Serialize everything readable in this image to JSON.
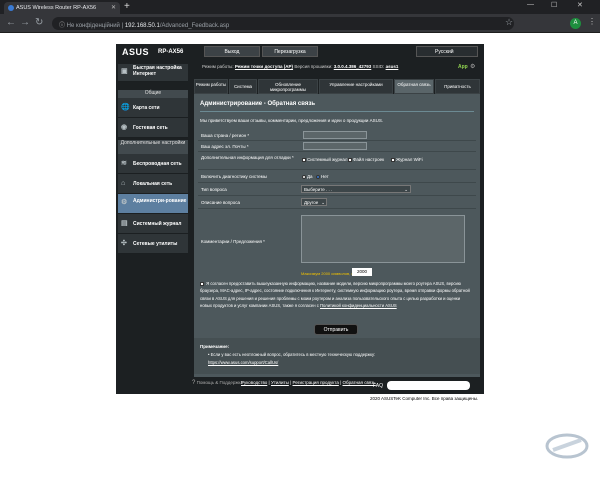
{
  "browser": {
    "tab_title": "ASUS Wireless Router RP-AX56",
    "url_security": "Не конфіденційний",
    "url_host": "192.168.50.1",
    "url_path": "/Advanced_Feedback.asp",
    "avatar_letter": "A"
  },
  "router": {
    "brand": "ASUS",
    "model": "RP-AX56",
    "logout": "Выход",
    "reboot": "Перезагрузка",
    "language": "Русский",
    "op_mode_label": "Режим работы:",
    "op_mode": "Режим точки доступа (AP)",
    "fw_label": "Версия прошивки:",
    "fw": "3.0.0.4.386_42793",
    "ssid_label": "SSID:",
    "ssid": "asus1",
    "app": "App"
  },
  "sidebar": {
    "quick_setup": "Быстрая настройка Интернет",
    "general": "Общие",
    "network_map": "Карта сети",
    "guest_network": "Гостевая сеть",
    "advanced": "Дополнительные настройки",
    "wireless": "Беспроводная сеть",
    "lan": "Локальная сеть",
    "administration": "Администри-рование",
    "system_log": "Системный журнал",
    "network_tools": "Сетевые утилиты"
  },
  "tabs": [
    "Режим работы",
    "Система",
    "Обновление микропрограммы",
    "Управление настройками",
    "Обратная связь",
    "Приватность"
  ],
  "form": {
    "title": "Администрирование - Обратная связь",
    "desc": "Мы приветствуем ваши отзывы, комментарии, предложения и идеи о продукции ASUS.",
    "country_label": "Ваша страна / регион *",
    "email_label": "Ваш адрес эл. Почты *",
    "extra_label": "Дополнительная информация для отладки *",
    "opt1": "Системный журнал",
    "opt2": "Файл настроек",
    "opt3": "Журнал WiFi",
    "diag_label": "Включить диагностику системы",
    "yes": "Да",
    "no": "Нет",
    "type_label": "Тип вопроса",
    "type_value": "Выберите . . .",
    "desc_label": "Описание вопроса",
    "desc_value": "Другое",
    "comment_label": "Комментарии / Предложения *",
    "max_label": "Максимум 2000 символов, осталось:",
    "max_value": "2000",
    "agree_text": "Я согласен предоставить вышеуказанную информацию, название модели, версию микропрограммы моего роутера ASUS, версию браузера, MAC-адрес, IP-адрес, состояние подключения к Интернету, системную информацию роутера, время отправки формы обратной связи в ASUS для решения и решения проблемы с моим роутером и анализа пользовательского опыта с целью разработки и оценки новых продуктов и услуг компании ASUS, также я согласен с",
    "agree_link": "Политикой конфиденциальности ASUS",
    "send": "Отправить"
  },
  "note": {
    "title": "Примечание:",
    "text": "Если у вас есть неотложный вопрос, обратитесь в местную техническую поддержку:",
    "link": "https://www.asus.com/support/CallUs/"
  },
  "footer": {
    "help": "Помощь & Поддержка",
    "manual": "Руководство",
    "utility": "Утилиты",
    "registration": "Регистрация продукта",
    "feedback": "Обратная связь",
    "faq": "FAQ"
  },
  "copyright": "2020 ASUSTeK Computer Inc. Все права защищены."
}
